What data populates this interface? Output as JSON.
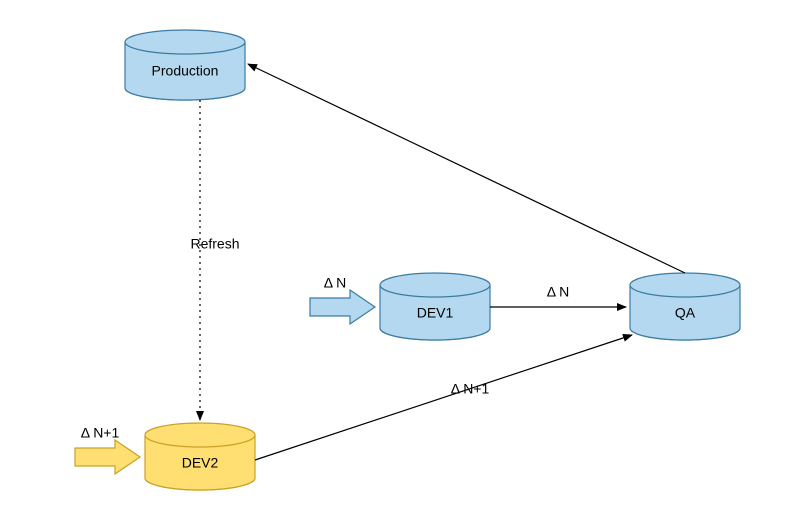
{
  "colors": {
    "blueFill": "#b3d8ef",
    "blueStroke": "#3b7ca3",
    "yellowFill": "#ffdf71",
    "yellowStroke": "#c9a227",
    "line": "#000000"
  },
  "nodes": {
    "production": {
      "label": "Production"
    },
    "dev1": {
      "label": "DEV1"
    },
    "dev2": {
      "label": "DEV2"
    },
    "qa": {
      "label": "QA"
    }
  },
  "arrows": {
    "toDev1": {
      "label": "Δ N"
    },
    "toDev2": {
      "label": "Δ N+1"
    }
  },
  "edges": {
    "refresh": {
      "label": "Refresh"
    },
    "dev1ToQa": {
      "label": "Δ N"
    },
    "dev2ToQa": {
      "label": "Δ N+1"
    },
    "qaToProd": {
      "label": ""
    }
  }
}
